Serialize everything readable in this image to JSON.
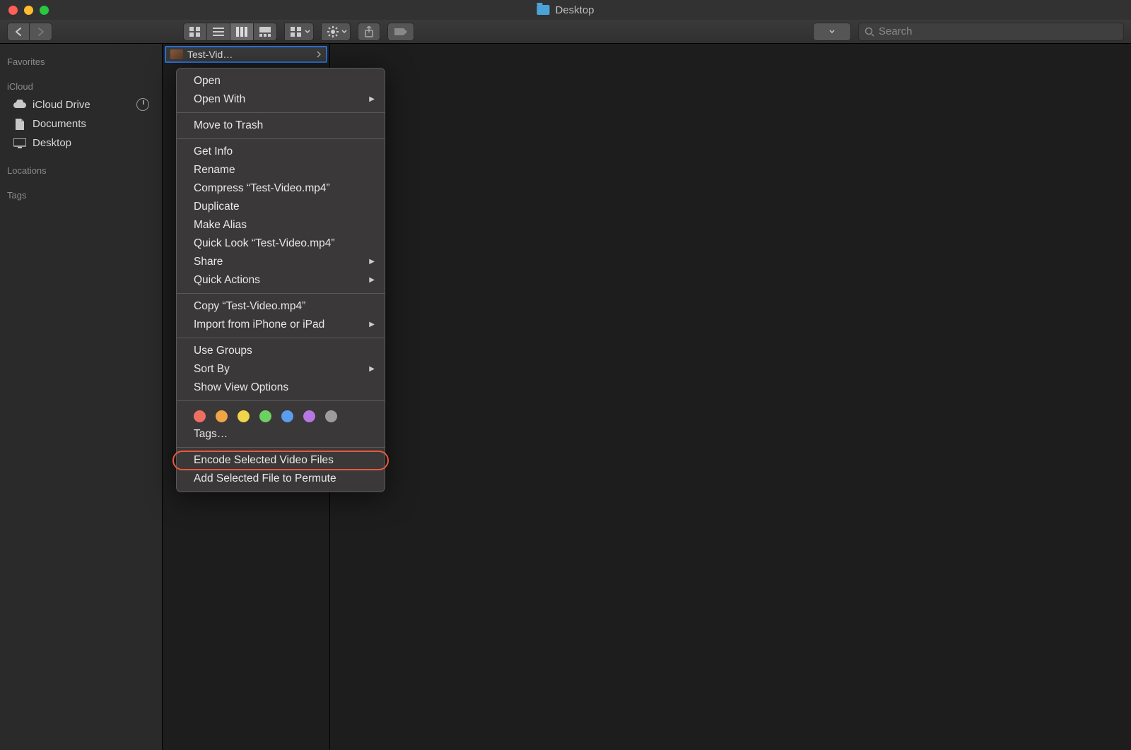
{
  "window": {
    "title": "Desktop"
  },
  "search": {
    "placeholder": "Search"
  },
  "sidebar": {
    "sections": [
      {
        "header": "Favorites",
        "items": []
      },
      {
        "header": "iCloud",
        "items": [
          {
            "label": "iCloud Drive",
            "icon": "cloud",
            "status": "syncing"
          },
          {
            "label": "Documents",
            "icon": "doc"
          },
          {
            "label": "Desktop",
            "icon": "desktop"
          }
        ]
      },
      {
        "header": "Locations",
        "items": []
      },
      {
        "header": "Tags",
        "items": []
      }
    ]
  },
  "selected_file": {
    "name": "Test-Video.mp4"
  },
  "context_menu": {
    "groups": [
      [
        {
          "label": "Open"
        },
        {
          "label": "Open With",
          "submenu": true
        }
      ],
      [
        {
          "label": "Move to Trash"
        }
      ],
      [
        {
          "label": "Get Info"
        },
        {
          "label": "Rename"
        },
        {
          "label": "Compress “Test-Video.mp4”"
        },
        {
          "label": "Duplicate"
        },
        {
          "label": "Make Alias"
        },
        {
          "label": "Quick Look “Test-Video.mp4”"
        },
        {
          "label": "Share",
          "submenu": true
        },
        {
          "label": "Quick Actions",
          "submenu": true
        }
      ],
      [
        {
          "label": "Copy “Test-Video.mp4”"
        },
        {
          "label": "Import from iPhone or iPad",
          "submenu": true
        }
      ],
      [
        {
          "label": "Use Groups"
        },
        {
          "label": "Sort By",
          "submenu": true
        },
        {
          "label": "Show View Options"
        }
      ]
    ],
    "tags_label": "Tags…",
    "tag_colors": [
      "#ef6e63",
      "#efa445",
      "#efd54a",
      "#6cd161",
      "#5a9ced",
      "#b678e0",
      "#9c9c9c"
    ],
    "final": [
      {
        "label": "Encode Selected Video Files",
        "highlighted": true
      },
      {
        "label": "Add Selected File to Permute"
      }
    ]
  }
}
